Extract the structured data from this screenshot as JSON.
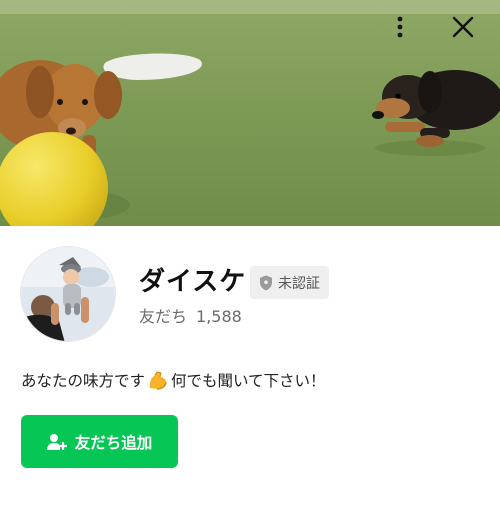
{
  "profile": {
    "name": "ダイスケ",
    "badge_label": "未認証",
    "friends_label": "友だち",
    "friends_count": "1,588",
    "status_before": "あなたの味方です",
    "status_after": "何でも聞いて下さい！",
    "status_emoji_icon": "flexed-biceps-icon"
  },
  "actions": {
    "add_friend_label": "友だち追加"
  },
  "header": {
    "more_icon": "more-vertical-icon",
    "close_icon": "close-icon"
  },
  "colors": {
    "accent_green": "#06c755",
    "badge_bg": "#efefef",
    "muted_text": "#6b6b6b"
  }
}
